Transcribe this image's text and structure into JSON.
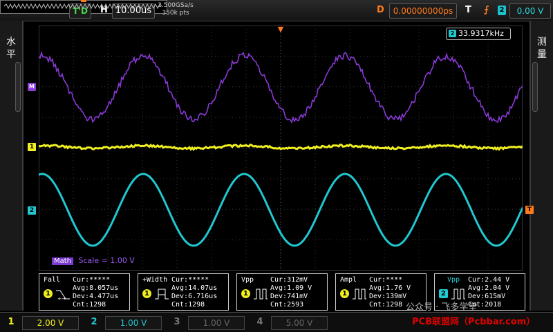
{
  "top_bar": {
    "run_state": "T'D",
    "horizontal_label": "H",
    "time_base": "10.00us",
    "sample_rate": "2.500GSa/s",
    "memory_depth": "350k pts",
    "delay_label": "D",
    "delay_value": "0.00000000ps",
    "trigger_label": "T",
    "trigger_source": "2",
    "trigger_level": "0.00 V"
  },
  "side_tabs": {
    "left": "水\n平",
    "right": "测\n量"
  },
  "screen": {
    "frequency_readout": "33.9317kHz",
    "frequency_source": "2",
    "marker_math": "M",
    "marker_ch1": "1",
    "marker_ch2": "2",
    "marker_trigger": "T",
    "math_label": "Math",
    "math_scale": "Scale = 1.00 V",
    "colors": {
      "ch1": "#f0f020",
      "ch2": "#20c8d0",
      "math": "#8a3ad8",
      "trigger": "#ff7a1a"
    }
  },
  "measurements": [
    {
      "name": "Fall",
      "source": "1",
      "cur": "Cur:*****",
      "avg": "Avg:8.057us",
      "dev": "Dev:4.477us",
      "cnt": "Cnt:1298"
    },
    {
      "name": "+Width",
      "source": "1",
      "cur": "Cur:*****",
      "avg": "Avg:14.07us",
      "dev": "Dev:6.716us",
      "cnt": "Cnt:1298"
    },
    {
      "name": "Vpp",
      "source": "1",
      "cur": "Cur:312mV",
      "avg": "Avg:1.09 V",
      "dev": "Dev:741mV",
      "cnt": "Cnt:2593"
    },
    {
      "name": "Ampl",
      "source": "1",
      "cur": "Cur:****",
      "avg": "Avg:1.76 V",
      "dev": "Dev:139mV",
      "cnt": "Cnt:1298"
    },
    {
      "name": "Vpp",
      "source": "2",
      "cur": "Cur:2.44 V",
      "avg": "Avg:2.04 V",
      "dev": "Dev:615mV",
      "cnt": "Cnt:2018"
    }
  ],
  "channels": [
    {
      "num": "1",
      "scale": "2.00 V",
      "color": "#f0f020",
      "active": true
    },
    {
      "num": "2",
      "scale": "1.00 V",
      "color": "#20c8d0",
      "active": true
    },
    {
      "num": "3",
      "scale": "1.00 V",
      "color": "#666666",
      "active": false
    },
    {
      "num": "4",
      "scale": "5.00 V",
      "color": "#666666",
      "active": false
    }
  ],
  "watermark": {
    "line1": "公众号 · 飞多学堂",
    "line2": "PCB联盟网（Pcbbar.com）"
  }
}
